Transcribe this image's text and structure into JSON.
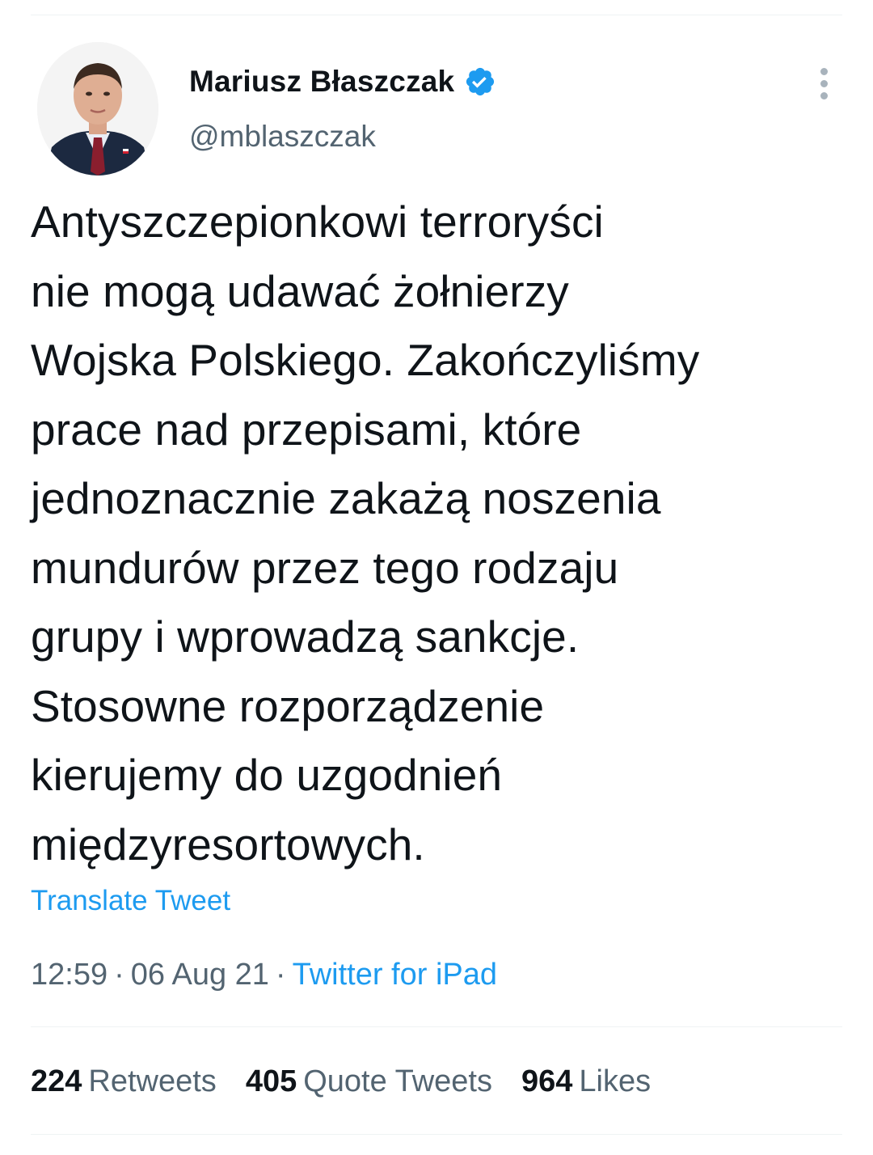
{
  "author": {
    "display_name": "Mariusz Błaszczak",
    "handle": "@mblaszczak",
    "verified": true
  },
  "tweet": {
    "lines": [
      "Antyszczepionkowi terroryści",
      "nie mogą udawać żołnierzy",
      "Wojska Polskiego. Zakończyliśmy",
      "prace nad przepisami, które",
      "jednoznacznie zakażą noszenia",
      "mundurów przez tego rodzaju",
      "grupy i wprowadzą sankcje.",
      "Stosowne rozporządzenie",
      "kierujemy do uzgodnień",
      "międzyresortowych."
    ],
    "translate_label": "Translate Tweet",
    "time": "12:59",
    "date": "06 Aug 21",
    "separator": "·",
    "source": "Twitter for iPad"
  },
  "stats": {
    "retweets_count": "224",
    "retweets_label": "Retweets",
    "quotes_count": "405",
    "quotes_label": "Quote Tweets",
    "likes_count": "964",
    "likes_label": "Likes"
  },
  "colors": {
    "accent": "#1d9bf0",
    "secondary_text": "#536471",
    "primary_text": "#0f1419",
    "divider": "#eff3f4"
  },
  "icons": {
    "verified": "verified-badge-icon",
    "more": "more-vertical-icon"
  }
}
